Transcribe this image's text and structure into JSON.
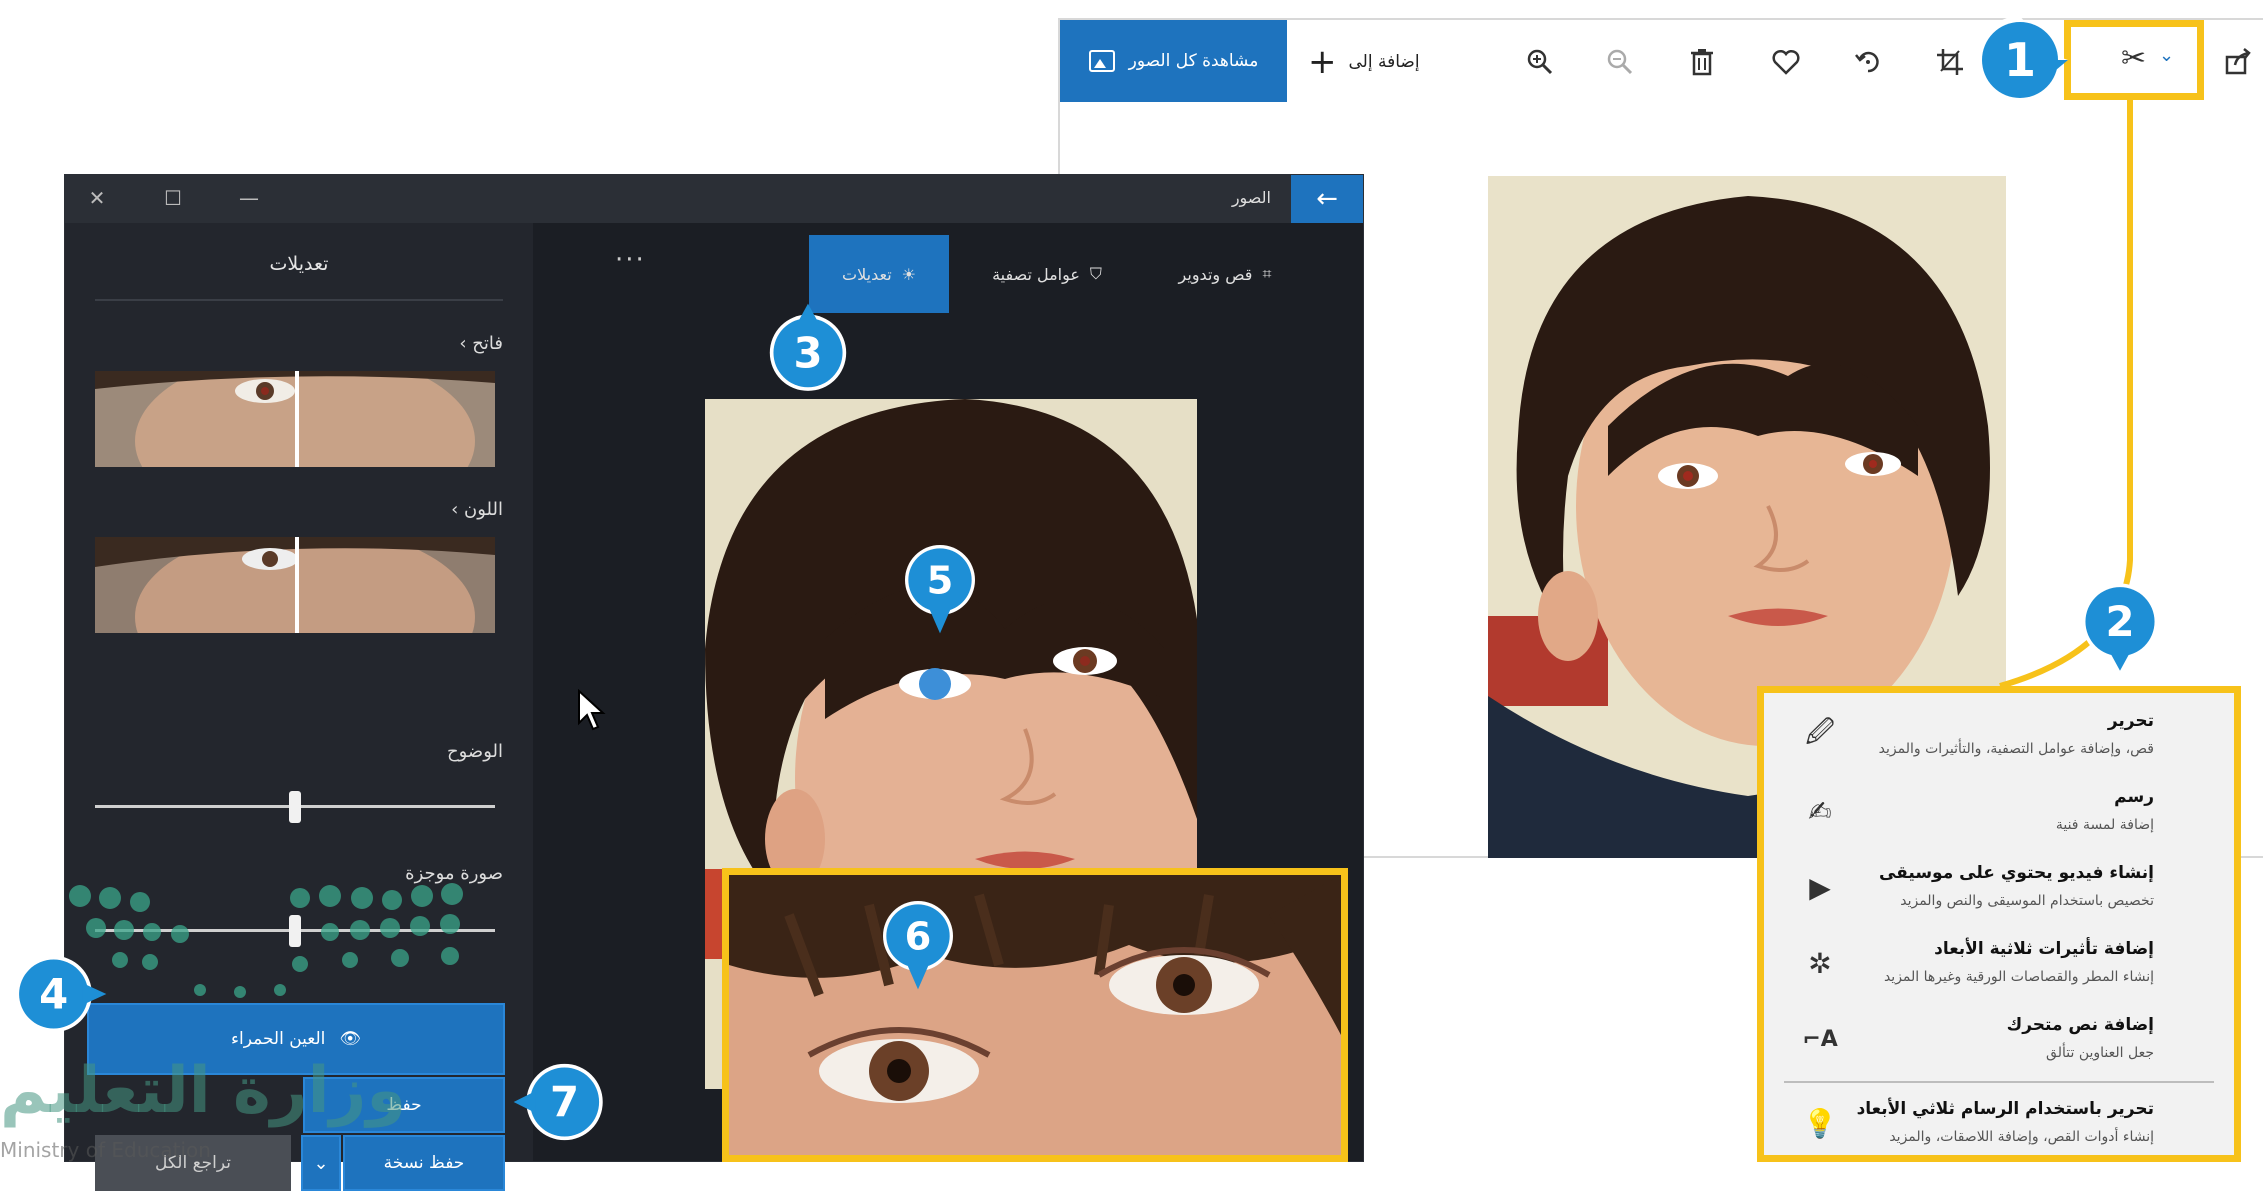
{
  "photos_window": {
    "view_all_label": "مشاهدة كل الصور",
    "add_to_label": "إضافة إلى",
    "toolbar_icons": [
      "share-icon",
      "edit-create-icon",
      "crop-icon",
      "rotate-icon",
      "favorite-icon",
      "delete-icon",
      "zoom-out-icon",
      "zoom-in-icon"
    ]
  },
  "edit_menu": {
    "items": [
      {
        "title": "تحرير",
        "desc": "قص، وإضافة عوامل التصفية، والتأثيرات والمزيد",
        "icon": "edit-icon"
      },
      {
        "title": "رسم",
        "desc": "إضافة لمسة فنية",
        "icon": "draw-icon"
      },
      {
        "title": "إنشاء فيديو يحتوي على موسيقى",
        "desc": "تخصيص باستخدام الموسيقى والنص والمزيد",
        "icon": "video-icon"
      },
      {
        "title": "إضافة تأثيرات ثلاثية الأبعاد",
        "desc": "إنشاء المطر والقصاصات الورقية وغيرها المزيد",
        "icon": "3d-effects-icon"
      },
      {
        "title": "إضافة نص متحرك",
        "desc": "جعل العناوين تتألق",
        "icon": "animated-text-icon"
      },
      {
        "title": "تحرير باستخدام الرسام ثلاثي الأبعاد",
        "desc": "إنشاء أدوات القص، وإضافة اللاصقات، والمزيد",
        "icon": "paint3d-icon"
      }
    ]
  },
  "editor": {
    "app_title": "الصور",
    "tabs": {
      "crop": "قص وتدوير",
      "filters": "عوامل تصفية",
      "adjustments": "تعديلات"
    },
    "panel": {
      "title": "تعديلات",
      "light": "فاتح",
      "color": "اللون",
      "clarity": "الوضوح",
      "vignette": "صورة موجزة",
      "clarity_level": 0.5,
      "vignette_level": 0.5
    },
    "red_eye": "العين الحمراء",
    "save": "حفظ",
    "save_copy": "حفظ نسخة",
    "undo_all": "تراجع الكل"
  },
  "callouts": [
    "1",
    "2",
    "3",
    "4",
    "5",
    "6",
    "7"
  ],
  "watermark": {
    "text": "وزارة التعليم",
    "subtext": "Ministry of Education"
  },
  "colors": {
    "accent": "#1e73be",
    "highlight": "#f7c21a",
    "callout": "#1e8fd6",
    "dark_bg": "#1b1e24"
  }
}
